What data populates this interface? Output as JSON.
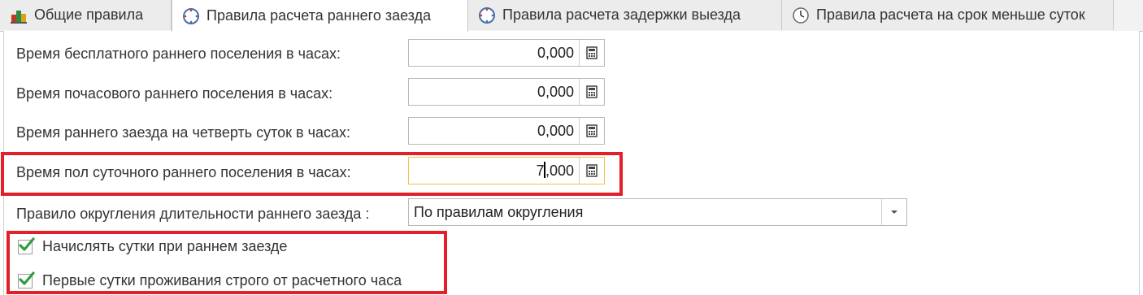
{
  "tabs": [
    {
      "label": "Общие правила",
      "icon": "hotel-icon",
      "active": false
    },
    {
      "label": "Правила расчета раннего заезда",
      "icon": "clock-icon",
      "active": true
    },
    {
      "label": "Правила расчета задержки выезда",
      "icon": "clock-icon",
      "active": false
    },
    {
      "label": "Правила расчета на срок меньше суток",
      "icon": "clock-icon",
      "active": false
    }
  ],
  "fields": {
    "free_early": {
      "label": "Время бесплатного раннего поселения в часах:",
      "value": "0,000"
    },
    "hourly_early": {
      "label": "Время почасового раннего поселения в часах:",
      "value": "0,000"
    },
    "quarter_day": {
      "label": "Время раннего заезда на четверть суток в часах:",
      "value": "0,000"
    },
    "half_day": {
      "label": "Время пол суточного раннего поселения в часах:",
      "value_before_caret": "7",
      "value_after_caret": ",000"
    },
    "rounding": {
      "label": "Правило округления длительности раннего заезда :",
      "value": "По правилам округления"
    }
  },
  "checkboxes": {
    "charge_days": {
      "label": "Начислять сутки при раннем заезде",
      "checked": true
    },
    "first_day_strict": {
      "label": "Первые сутки проживания строго от расчетного часа",
      "checked": true
    }
  },
  "colors": {
    "highlight": "#e3202a",
    "check": "#2e9e3f",
    "focus_border": "#f0c34a"
  }
}
